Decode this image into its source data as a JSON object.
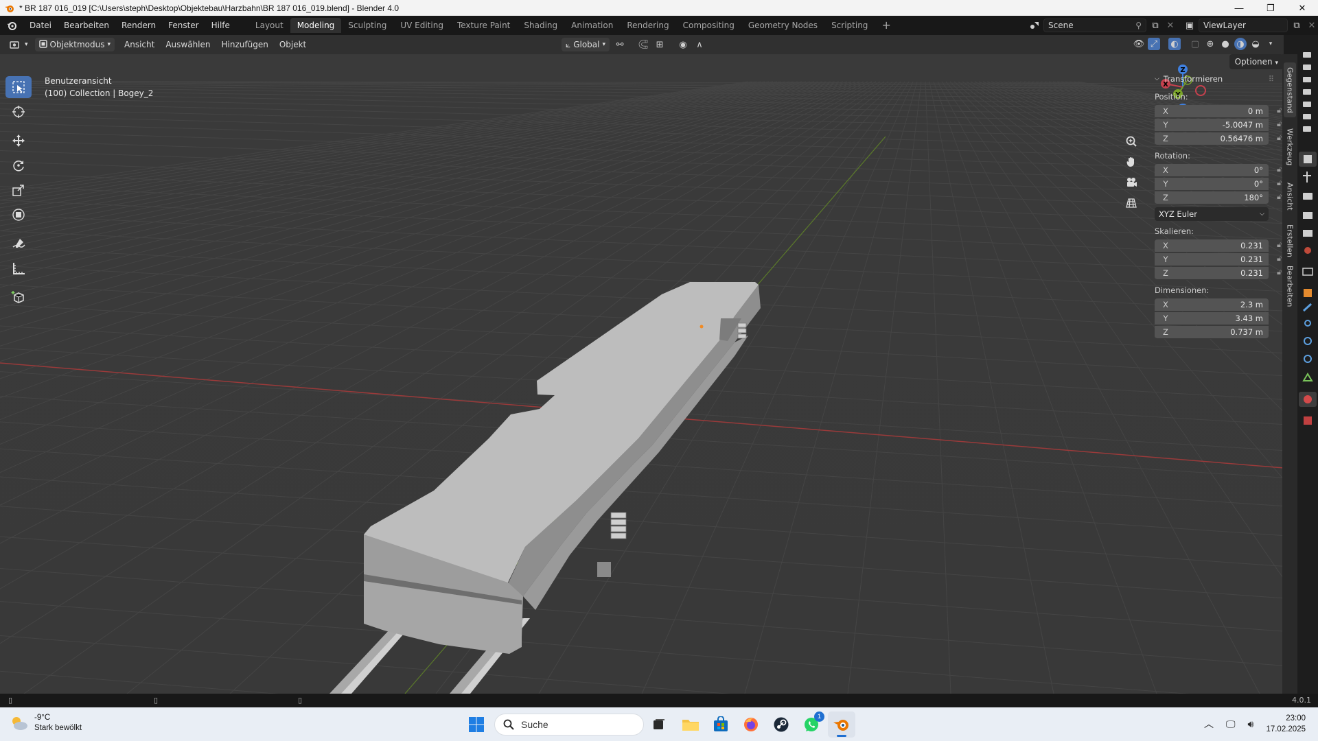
{
  "window": {
    "title": "* BR 187 016_019 [C:\\Users\\steph\\Desktop\\Objektebau\\Harzbahn\\BR 187 016_019.blend] - Blender 4.0",
    "minimize": "—",
    "maximize": "❐",
    "close": "✕"
  },
  "menu": [
    "Datei",
    "Bearbeiten",
    "Rendern",
    "Fenster",
    "Hilfe"
  ],
  "workspaces": [
    "Layout",
    "Modeling",
    "Sculpting",
    "UV Editing",
    "Texture Paint",
    "Shading",
    "Animation",
    "Rendering",
    "Compositing",
    "Geometry Nodes",
    "Scripting"
  ],
  "active_workspace": "Modeling",
  "workspace_add": "+",
  "scene": {
    "name": "Scene",
    "view_layer": "ViewLayer"
  },
  "header": {
    "mode": "Objektmodus",
    "menus": [
      "Ansicht",
      "Auswählen",
      "Hinzufügen",
      "Objekt"
    ],
    "orientation": "Global"
  },
  "viewport": {
    "view_name": "Benutzeransicht",
    "collection": "(100) Collection | Bogey_2",
    "options": "Optionen"
  },
  "gizmo": {
    "x": "X",
    "y": "Y",
    "z": "Z"
  },
  "npanel": {
    "title": "Transformieren",
    "position_label": "Position:",
    "position": [
      {
        "axis": "X",
        "value": "0 m"
      },
      {
        "axis": "Y",
        "value": "-5.0047 m"
      },
      {
        "axis": "Z",
        "value": "0.56476 m"
      }
    ],
    "rotation_label": "Rotation:",
    "rotation": [
      {
        "axis": "X",
        "value": "0°"
      },
      {
        "axis": "Y",
        "value": "0°"
      },
      {
        "axis": "Z",
        "value": "180°"
      }
    ],
    "rotation_mode": "XYZ Euler",
    "scale_label": "Skalieren:",
    "scale": [
      {
        "axis": "X",
        "value": "0.231"
      },
      {
        "axis": "Y",
        "value": "0.231"
      },
      {
        "axis": "Z",
        "value": "0.231"
      }
    ],
    "dimensions_label": "Dimensionen:",
    "dimensions": [
      {
        "axis": "X",
        "value": "2.3 m"
      },
      {
        "axis": "Y",
        "value": "3.43 m"
      },
      {
        "axis": "Z",
        "value": "0.737 m"
      }
    ]
  },
  "side_tabs": [
    "Gegenstand",
    "Werkzeug",
    "Ansicht",
    "Erstellen",
    "Bearbeiten"
  ],
  "status": {
    "version": "4.0.1"
  },
  "taskbar": {
    "weather_temp": "-9°C",
    "weather_desc": "Stark bewölkt",
    "search": "Suche",
    "time": "23:00",
    "date": "17.02.2025",
    "whatsapp_badge": "1"
  },
  "colors": {
    "accent": "#4772b3",
    "axis_x": "#c8414e",
    "axis_y": "#7aa428",
    "axis_z": "#3f80e0"
  }
}
